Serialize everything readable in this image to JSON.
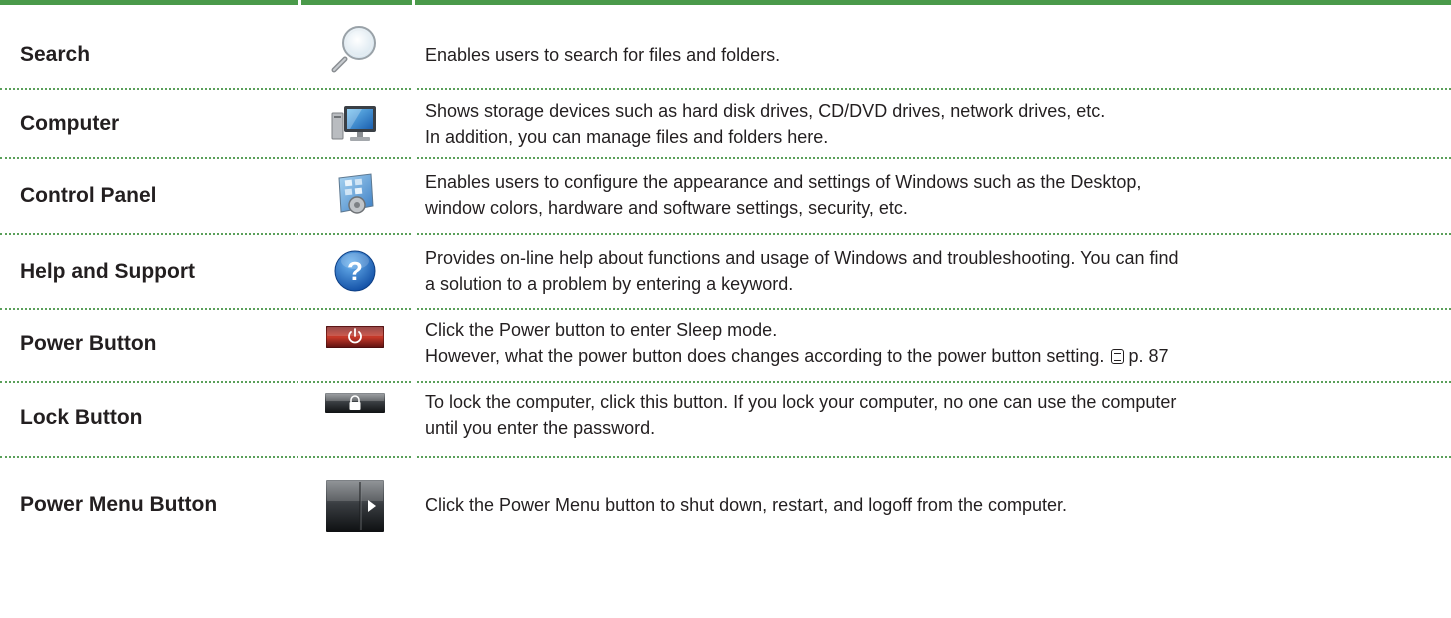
{
  "rows": [
    {
      "name": "Search",
      "icon": "magnifier-icon",
      "desc": [
        "Enables users to search for files and folders."
      ]
    },
    {
      "name": "Computer",
      "icon": "computer-icon",
      "desc": [
        "Shows storage devices such as hard disk drives, CD/DVD drives, network drives, etc.",
        "In addition, you can manage files and folders here."
      ]
    },
    {
      "name": "Control Panel",
      "icon": "control-panel-icon",
      "desc": [
        "Enables users to configure the appearance and settings of Windows such as the Desktop,",
        "window colors, hardware and software settings, security, etc."
      ]
    },
    {
      "name": "Help and Support",
      "icon": "help-icon",
      "desc": [
        "Provides on-line help about functions and usage of Windows and troubleshooting. You can find",
        "a solution to a problem by entering a keyword."
      ]
    },
    {
      "name": "Power Button",
      "icon": "power-button-icon",
      "desc": [
        "Click the Power button to enter Sleep mode.",
        "However, what the power button does changes according to the power button setting."
      ],
      "ref": "p. 87"
    },
    {
      "name": "Lock Button",
      "icon": "lock-button-icon",
      "desc": [
        "To lock the computer, click this button. If you lock your computer, no one can use the computer",
        "until you enter the password."
      ]
    },
    {
      "name": "Power Menu Button",
      "icon": "power-menu-arrow-icon",
      "desc": [
        "Click the Power Menu button to shut down, restart, and logoff from the computer."
      ]
    }
  ],
  "colors": {
    "rule": "#4a9a4a",
    "text": "#231f20"
  }
}
